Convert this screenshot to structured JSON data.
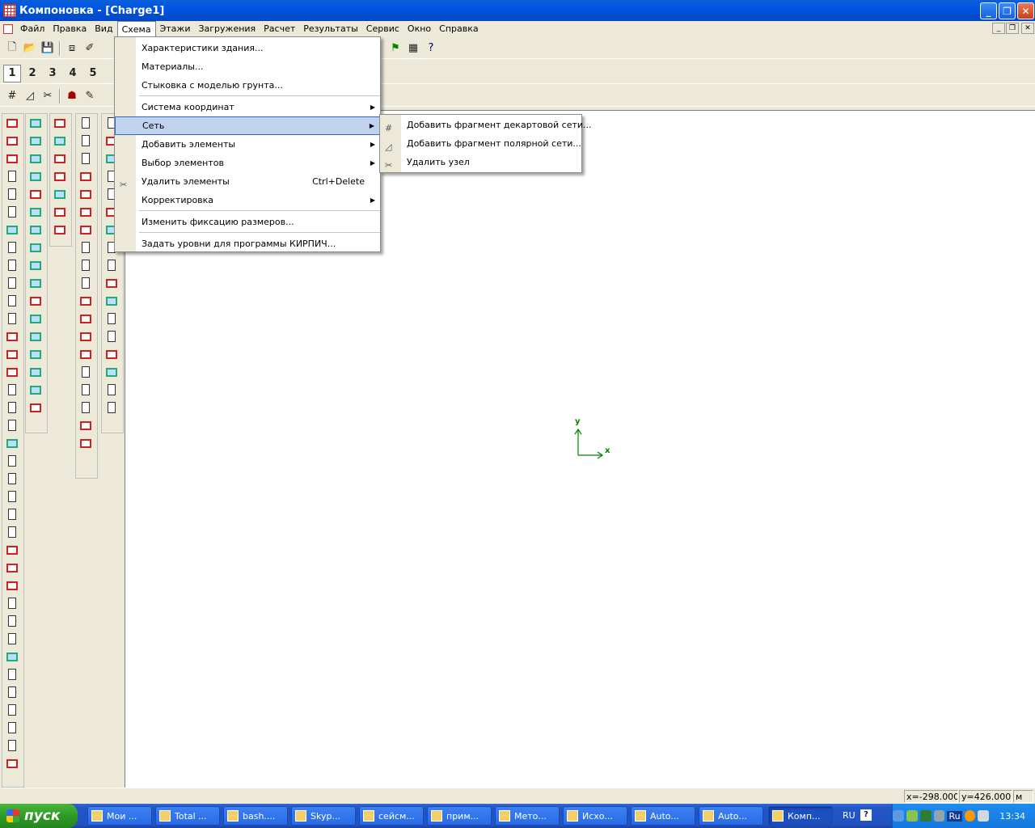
{
  "window": {
    "title": "Компоновка - [Charge1]",
    "minimize": "_",
    "maximize": "❐",
    "close": "✕"
  },
  "menubar": {
    "items": [
      "Файл",
      "Правка",
      "Вид",
      "Схема",
      "Этажи",
      "Загружения",
      "Расчет",
      "Результаты",
      "Сервис",
      "Окно",
      "Справка"
    ],
    "active": "Схема"
  },
  "floors_toolbar": {
    "items": [
      "1",
      "2",
      "3",
      "4",
      "5"
    ]
  },
  "schema_menu": {
    "items": [
      {
        "label": "Характеристики здания..."
      },
      {
        "label": "Материалы..."
      },
      {
        "label": "Стыковка с моделью грунта..."
      },
      {
        "label": "Система координат",
        "submenu": true
      },
      {
        "label": "Сеть",
        "submenu": true,
        "highlighted": true
      },
      {
        "label": "Добавить элементы",
        "submenu": true
      },
      {
        "label": "Выбор элементов",
        "submenu": true
      },
      {
        "label": "Удалить элементы",
        "shortcut": "Ctrl+Delete"
      },
      {
        "label": "Корректировка",
        "submenu": true
      },
      {
        "label": "Изменить фиксацию размеров..."
      },
      {
        "label": "Задать уровни для программы КИРПИЧ..."
      }
    ]
  },
  "net_submenu": {
    "items": [
      {
        "label": "Добавить фрагмент декартовой сети...",
        "icon": "cartesian-grid-icon"
      },
      {
        "label": "Добавить фрагмент полярной сети...",
        "icon": "polar-grid-icon"
      },
      {
        "label": "Удалить узел",
        "icon": "delete-node-icon"
      }
    ]
  },
  "axes": {
    "x": "x",
    "y": "y",
    "color": "#008000"
  },
  "statusbar": {
    "x": "x=-298.0000",
    "y": "y=426.00000",
    "unit": "м"
  },
  "taskbar": {
    "start": "пуск",
    "tasks": [
      "Мои ...",
      "Total ...",
      "bash....",
      "Skyp...",
      "сейсм...",
      "прим...",
      "Мето...",
      "Исхо...",
      "Auto...",
      "Auto...",
      "Комп..."
    ],
    "active_task": "Комп...",
    "lang": "RU",
    "ime": "Ru",
    "clock": "13:34"
  }
}
